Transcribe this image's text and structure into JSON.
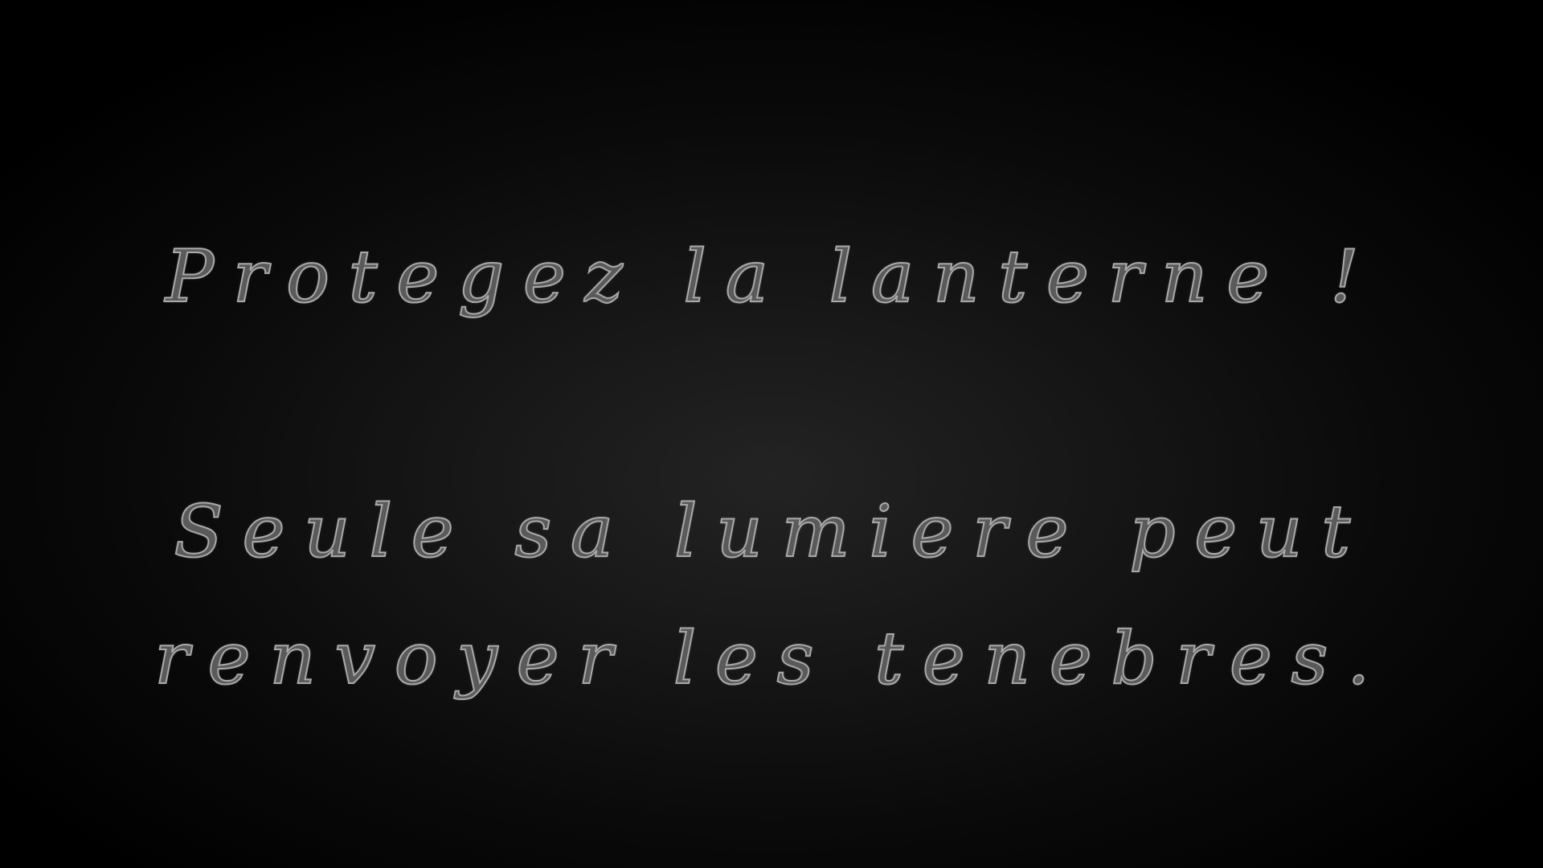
{
  "intro": {
    "line_1": "Protegez la lanterne !",
    "line_2": "Seule sa lumiere peut",
    "line_3": "renvoyer les tenebres."
  },
  "colors": {
    "background_center": "#232323",
    "background_edge": "#000000",
    "text_outline": "#a9a9a9",
    "text_fill": "#5a5a5a"
  }
}
